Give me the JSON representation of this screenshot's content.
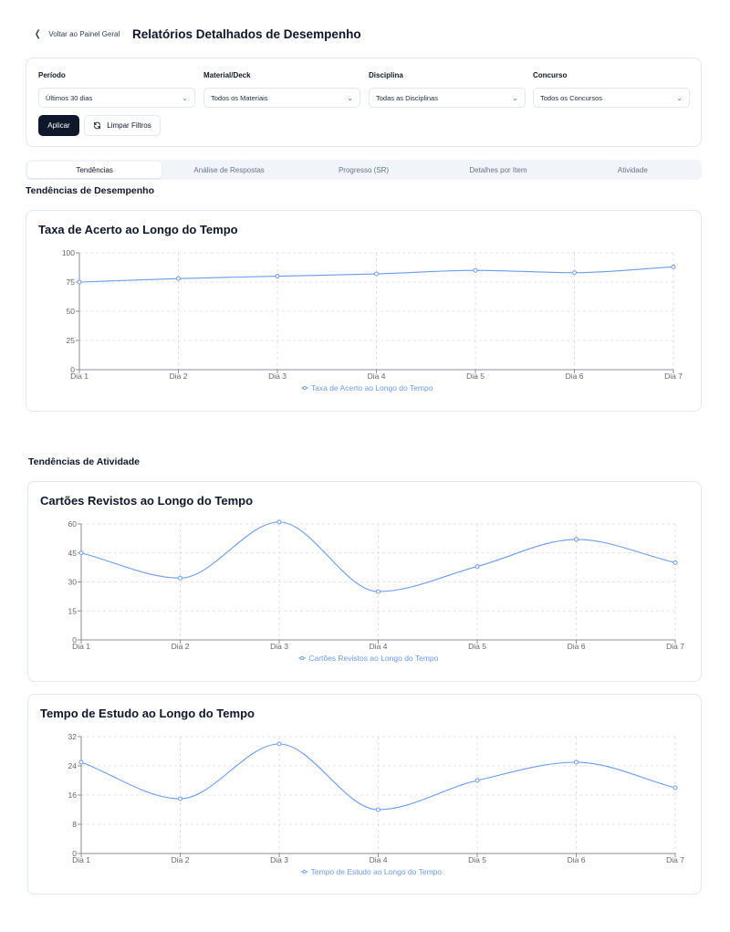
{
  "header": {
    "back_label": "Voltar ao Painel Geral",
    "title": "Relatórios Detalhados de Desempenho"
  },
  "filters": [
    {
      "label": "Período",
      "value": "Últimos 30 dias"
    },
    {
      "label": "Material/Deck",
      "value": "Todos os Materiais"
    },
    {
      "label": "Disciplina",
      "value": "Todas as Disciplinas"
    },
    {
      "label": "Concurso",
      "value": "Todos os Concursos"
    }
  ],
  "actions": {
    "apply_label": "Aplicar",
    "clear_label": "Limpar Filtros"
  },
  "tabs": [
    "Tendências",
    "Análise de Respostas",
    "Progresso (SR)",
    "Detalhes por Item",
    "Atividade"
  ],
  "active_tab": "Tendências",
  "sections": {
    "performance_title": "Tendências de Desempenho",
    "activity_title": "Tendências de Atividade"
  },
  "colors": {
    "line": "#6b9cf0",
    "grid": "#d8dde3",
    "axis": "#8a8f98",
    "primary_button": "#0f172a"
  },
  "chart_data": [
    {
      "type": "line",
      "title": "Taxa de Acerto ao Longo do Tempo",
      "categories": [
        "Dia 1",
        "Dia 2",
        "Dia 3",
        "Dia 4",
        "Dia 5",
        "Dia 6",
        "Dia 7"
      ],
      "series": [
        {
          "name": "Taxa de Acerto ao Longo do Tempo",
          "values": [
            75,
            78,
            80,
            82,
            85,
            83,
            88
          ]
        }
      ],
      "yticks": [
        0,
        25,
        50,
        75,
        100
      ],
      "ylim": [
        0,
        100
      ],
      "grid": true,
      "legend": "bottom"
    },
    {
      "type": "line",
      "title": "Cartões Revistos ao Longo do Tempo",
      "categories": [
        "Dia 1",
        "Dia 2",
        "Dia 3",
        "Dia 4",
        "Dia 5",
        "Dia 6",
        "Dia 7"
      ],
      "series": [
        {
          "name": "Cartões Revistos ao Longo do Tempo",
          "values": [
            45,
            32,
            61,
            25,
            38,
            52,
            40
          ]
        }
      ],
      "yticks": [
        0,
        15,
        30,
        45,
        60
      ],
      "ylim": [
        0,
        60
      ],
      "grid": true,
      "legend": "bottom"
    },
    {
      "type": "line",
      "title": "Tempo de Estudo ao Longo do Tempo",
      "categories": [
        "Dia 1",
        "Dia 2",
        "Dia 3",
        "Dia 4",
        "Dia 5",
        "Dia 6",
        "Dia 7"
      ],
      "series": [
        {
          "name": "Tempo de Estudo ao Longo do Tempo",
          "values": [
            25,
            15,
            30,
            12,
            20,
            25,
            18
          ]
        }
      ],
      "yticks": [
        0,
        8,
        16,
        24,
        32
      ],
      "ylim": [
        0,
        32
      ],
      "grid": true,
      "legend": "bottom"
    }
  ]
}
